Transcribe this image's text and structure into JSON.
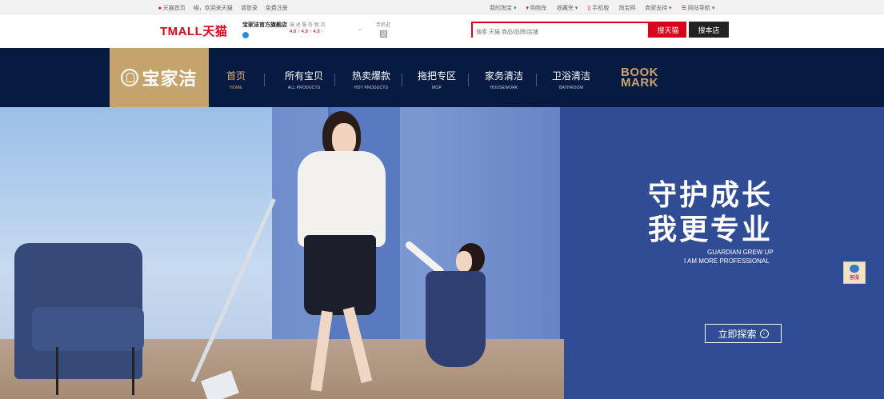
{
  "topbar": {
    "left": [
      "天猫首页",
      "喵，欢迎来天猫",
      "请登录",
      "免费注册"
    ],
    "right": [
      "我的淘宝",
      "购物车",
      "收藏夹",
      "手机版",
      "淘宝网",
      "商家支持",
      "网站导航"
    ]
  },
  "header": {
    "logo": "TMALL天猫",
    "shop_name": "宝家洁官方旗舰店",
    "rating_labels": "描 述  服 务  物 流",
    "rating_scores": "4.8 ↑  4.8 ↑  4.8 ↑",
    "mobile_label": "手机逛",
    "search_placeholder": "搜索 天猫 商品/品牌/店铺",
    "btn_tmall": "搜天猫",
    "btn_shop": "搜本店"
  },
  "nav": {
    "brand": "宝家洁",
    "items": [
      {
        "cn": "首页",
        "en": "HOME"
      },
      {
        "cn": "所有宝贝",
        "en": "ALL PRODUCTS"
      },
      {
        "cn": "热卖爆款",
        "en": "HOT PRODUCTS"
      },
      {
        "cn": "拖把专区",
        "en": "MOP"
      },
      {
        "cn": "家务清洁",
        "en": "HOUSEWORK"
      },
      {
        "cn": "卫浴清洁",
        "en": "BATHROOM"
      }
    ],
    "bookmark1": "BOOK",
    "bookmark2": "MARK"
  },
  "hero": {
    "slogan1": "守护成长",
    "slogan2": "我更专业",
    "en1": "GUARDIAN GREW UP",
    "en2": "I AM MORE PROFESSIONAL",
    "explore": "立即探索"
  },
  "float": {
    "service": "客服"
  },
  "colors": {
    "brand_red": "#d9001b",
    "nav_bg": "#071b42",
    "brand_gold": "#c4a46c"
  }
}
